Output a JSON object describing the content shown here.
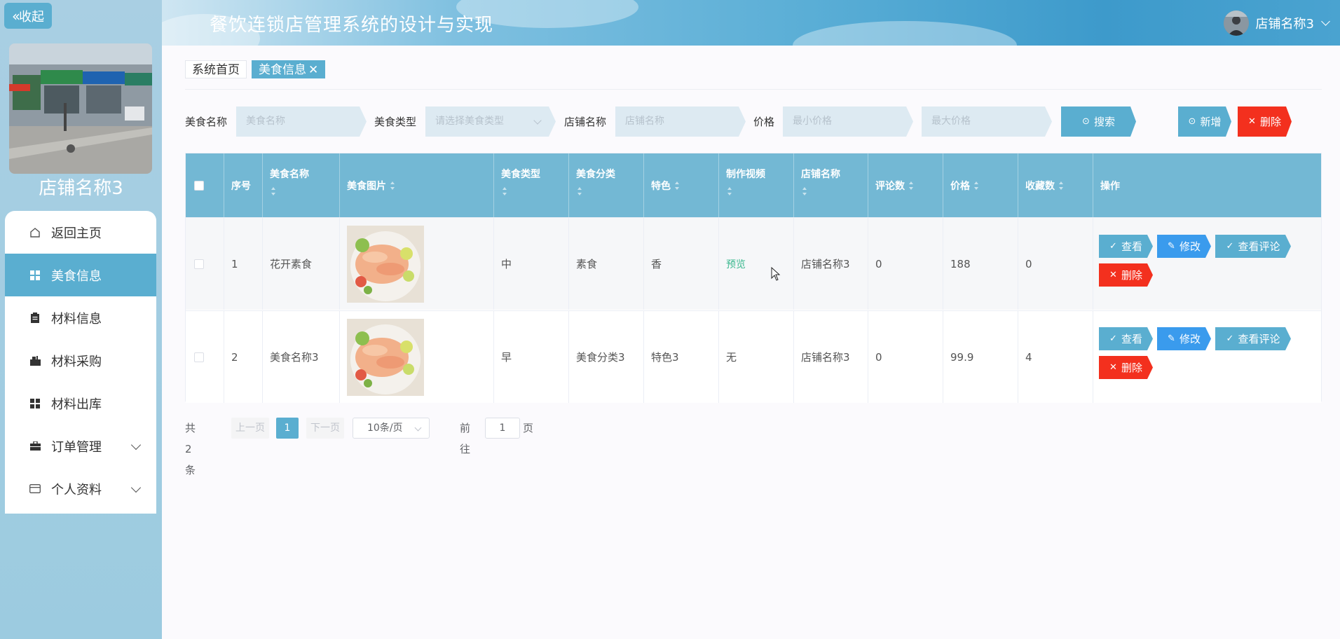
{
  "sidebar": {
    "collapse_label": "收起",
    "store_name": "店铺名称3",
    "items": [
      {
        "label": "返回主页",
        "icon": "home-icon"
      },
      {
        "label": "美食信息",
        "icon": "grid-icon",
        "active": true
      },
      {
        "label": "材料信息",
        "icon": "clipboard-icon"
      },
      {
        "label": "材料采购",
        "icon": "purchase-icon"
      },
      {
        "label": "材料出库",
        "icon": "grid-icon"
      },
      {
        "label": "订单管理",
        "icon": "briefcase-icon",
        "has_submenu": true
      },
      {
        "label": "个人资料",
        "icon": "card-icon",
        "has_submenu": true
      }
    ]
  },
  "header": {
    "title": "餐饮连锁店管理系统的设计与实现",
    "user_name": "店铺名称3"
  },
  "tabs": [
    {
      "label": "系统首页"
    },
    {
      "label": "美食信息",
      "active": true,
      "close": "✕"
    }
  ],
  "search": {
    "name_label": "美食名称",
    "name_placeholder": "美食名称",
    "type_label": "美食类型",
    "type_placeholder": "请选择美食类型",
    "store_label": "店铺名称",
    "store_placeholder": "店铺名称",
    "price_label": "价格",
    "min_price_placeholder": "最小价格",
    "max_price_placeholder": "最大价格",
    "search_button": "搜索",
    "add_button": "新增",
    "delete_button": "删除"
  },
  "table": {
    "columns": [
      "序号",
      "美食名称",
      "美食图片",
      "美食类型",
      "美食分类",
      "特色",
      "制作视频",
      "店铺名称",
      "评论数",
      "价格",
      "收藏数",
      "操作"
    ],
    "rows": [
      {
        "index": "1",
        "name": "花开素食",
        "type": "中",
        "category": "素食",
        "feature": "香",
        "video": "预览",
        "store": "店铺名称3",
        "comments": "0",
        "price": "188",
        "favorites": "0"
      },
      {
        "index": "2",
        "name": "美食名称3",
        "type": "早",
        "category": "美食分类3",
        "feature": "特色3",
        "video": "无",
        "store": "店铺名称3",
        "comments": "0",
        "price": "99.9",
        "favorites": "4"
      }
    ],
    "actions": {
      "view": "查看",
      "edit": "修改",
      "view_comments": "查看评论",
      "delete": "删除"
    }
  },
  "pagination": {
    "total": "共 2 条",
    "prev": "上一页",
    "current": "1",
    "next": "下一页",
    "page_size": "10条/页",
    "goto_label": "前往",
    "goto_value": "1",
    "page_suffix": "页"
  },
  "colors": {
    "accent": "#5aaed0",
    "danger": "#f3301e",
    "primary": "#3a9bed"
  }
}
